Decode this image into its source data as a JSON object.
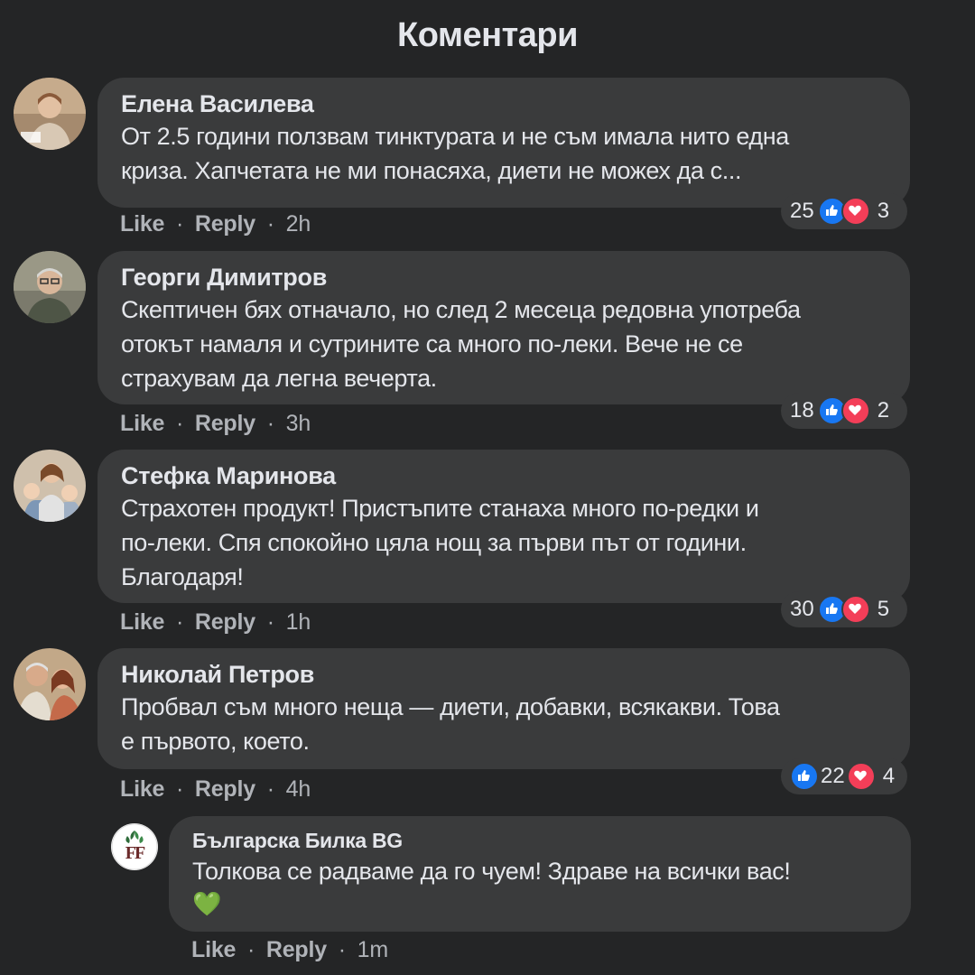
{
  "page": {
    "title": "Коментари"
  },
  "comments": [
    {
      "author": "Елена Василева",
      "lines": [
        "От 2.5 години ползвам тинктурата и не съм имала нито една",
        "криза. Хапчетата не ми понасяха, диети не можех да с..."
      ],
      "like_label": "Like",
      "reply_label": "Reply",
      "time": "2h",
      "likes": "25",
      "loves": "3",
      "avatar_colors": [
        "#b89a7a",
        "#6a5a4a"
      ]
    },
    {
      "author": "Георги Димитров",
      "lines": [
        "Скептичен бях отначало, но след 2 месеца редовна употреба",
        "отокът намаля и сутрините са много по-леки. Вече не се",
        "страхувам да легна вечерта."
      ],
      "like_label": "Like",
      "reply_label": "Reply",
      "time": "3h",
      "likes": "18",
      "loves": "2",
      "avatar_colors": [
        "#8a8a80",
        "#4a4a3e"
      ]
    },
    {
      "author": "Стефка Маринова",
      "lines": [
        "Страхотен продукт! Пристъпите станаха много по-редки и",
        "по-леки. Спя спокойно цяла нощ за първи път от години.",
        "Благодаря!"
      ],
      "like_label": "Like",
      "reply_label": "Reply",
      "time": "1h",
      "likes": "30",
      "loves": "5",
      "avatar_colors": [
        "#d9b8a0",
        "#7a6a5a"
      ]
    },
    {
      "author": "Николай Петров",
      "lines": [
        "Пробвал съм много неща — диети, добавки, всякакви. Това",
        "е първото, което."
      ],
      "like_label": "Like",
      "reply_label": "Reply",
      "time": "4h",
      "likes": "22",
      "loves": "4",
      "avatar_colors": [
        "#c9a080",
        "#6a5040"
      ]
    }
  ],
  "reply": {
    "author": "Българска Билка BG",
    "lines": [
      "Толкова се радваме да го чуем! Здраве на всички вас!"
    ],
    "emoji": "💚",
    "like_label": "Like",
    "reply_label": "Reply",
    "time": "1m",
    "logo_text": "FF",
    "brand_color": "#2e6b3a"
  },
  "separator": "·",
  "icons": {
    "like": "thumbs-up-icon",
    "love": "heart-icon"
  },
  "colors": {
    "like": "#1877f2",
    "love": "#f33e58",
    "bubble": "#3a3b3c",
    "background": "#242526"
  }
}
